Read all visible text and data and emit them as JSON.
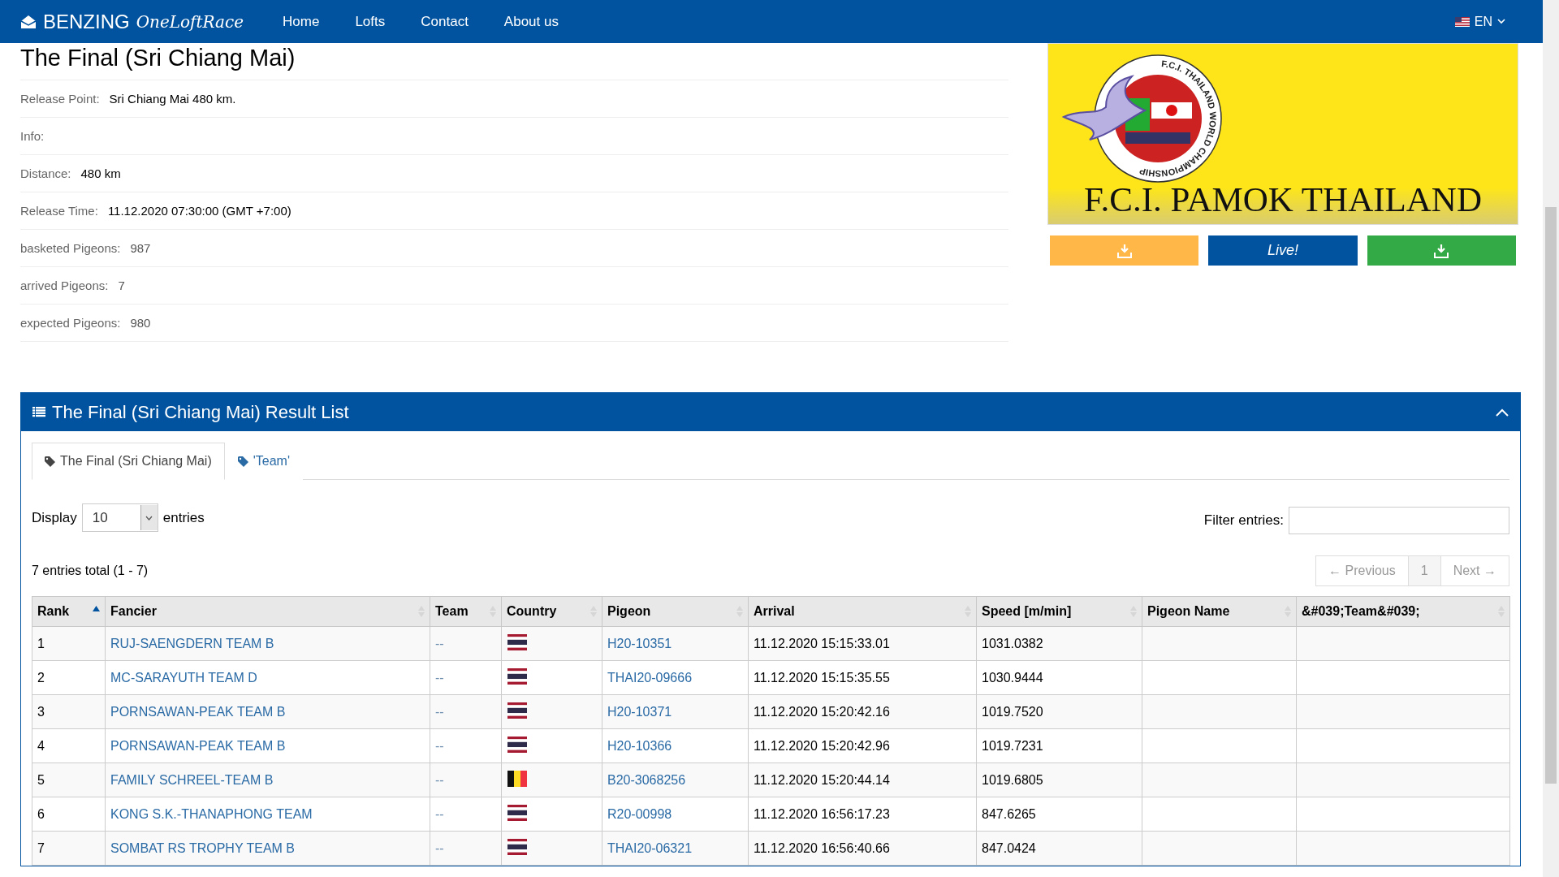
{
  "navbar": {
    "brand": "BENZING",
    "brand_script": "OneLoftRace",
    "links": [
      "Home",
      "Lofts",
      "Contact",
      "About us"
    ],
    "language": "EN"
  },
  "race": {
    "title": "The Final (Sri Chiang Mai)",
    "details": [
      {
        "label": "Release Point:",
        "value": "Sri Chiang Mai 480 km.",
        "emphasis": true
      },
      {
        "label": "Info:"
      },
      {
        "label": "Distance:",
        "value": "480 km",
        "emphasis": true
      },
      {
        "label": "Release Time:",
        "value": "11.12.2020 07:30:00 (GMT +7:00)",
        "emphasis": true
      },
      {
        "label": "basketed Pigeons:",
        "value": "987",
        "emphasis": false
      },
      {
        "label": "arrived Pigeons:",
        "value": "7",
        "emphasis": false
      },
      {
        "label": "expected Pigeons:",
        "value": "980",
        "emphasis": false
      }
    ]
  },
  "banner": {
    "text": "F.C.I. PAMOK THAILAND",
    "emblem_text": "F.C.I. THAILAND WORLD CHAMPIONSHIP"
  },
  "action_buttons": [
    {
      "kind": "download",
      "color": "#ffb848"
    },
    {
      "kind": "live",
      "label": "Live!",
      "color": "#01539f"
    },
    {
      "kind": "download",
      "color": "#33aa46"
    }
  ],
  "results": {
    "title": "The Final (Sri Chiang Mai) Result List",
    "tabs": [
      {
        "label": "The Final (Sri Chiang Mai)",
        "selected": true
      },
      {
        "label": "'Team'",
        "selected": false
      }
    ],
    "display": {
      "label": "Display",
      "value": "10",
      "suffix": "entries"
    },
    "filter": {
      "label": "Filter entries:"
    },
    "total": "7 entries total (1 - 7)",
    "pagination": {
      "previous": "← Previous",
      "page": "1",
      "next": "Next →"
    },
    "columns": [
      {
        "label": "Rank",
        "sorted": true
      },
      {
        "label": "Fancier",
        "sorted": false
      },
      {
        "label": "Team",
        "sorted": false
      },
      {
        "label": "Country",
        "sorted": false
      },
      {
        "label": "Pigeon",
        "sorted": false
      },
      {
        "label": "Arrival",
        "sorted": false
      },
      {
        "label": "Speed [m/min]",
        "sorted": false
      },
      {
        "label": "Pigeon Name",
        "sorted": false
      },
      {
        "label": "&#039;Team&#039;",
        "sorted": false
      }
    ],
    "rows": [
      {
        "rank": "1",
        "fancier": "RUJ-SAENGDERN TEAM B",
        "team": "--",
        "kind": "thailand",
        "pigeon": "H20-10351",
        "arrival": "11.12.2020 15:15:33.01",
        "speed": "1031.0382"
      },
      {
        "rank": "2",
        "fancier": "MC-SARAYUTH TEAM D",
        "team": "--",
        "kind": "thailand",
        "pigeon": "THAI20-09666",
        "arrival": "11.12.2020 15:15:35.55",
        "speed": "1030.9444"
      },
      {
        "rank": "3",
        "fancier": "PORNSAWAN-PEAK TEAM B",
        "team": "--",
        "kind": "thailand",
        "pigeon": "H20-10371",
        "arrival": "11.12.2020 15:20:42.16",
        "speed": "1019.7520"
      },
      {
        "rank": "4",
        "fancier": "PORNSAWAN-PEAK TEAM B",
        "team": "--",
        "kind": "thailand",
        "pigeon": "H20-10366",
        "arrival": "11.12.2020 15:20:42.96",
        "speed": "1019.7231"
      },
      {
        "rank": "5",
        "fancier": "FAMILY SCHREEL-TEAM B",
        "team": "--",
        "kind": "belgium",
        "pigeon": "B20-3068256",
        "arrival": "11.12.2020 15:20:44.14",
        "speed": "1019.6805"
      },
      {
        "rank": "6",
        "fancier": "KONG S.K.-THANAPHONG TEAM",
        "team": "--",
        "kind": "thailand",
        "pigeon": "R20-00998",
        "arrival": "11.12.2020 16:56:17.23",
        "speed": "847.6265"
      },
      {
        "rank": "7",
        "fancier": "SOMBAT RS TROPHY TEAM B",
        "team": "--",
        "kind": "thailand",
        "pigeon": "THAI20-06321",
        "arrival": "11.12.2020 16:56:40.66",
        "speed": "847.0424"
      }
    ]
  }
}
